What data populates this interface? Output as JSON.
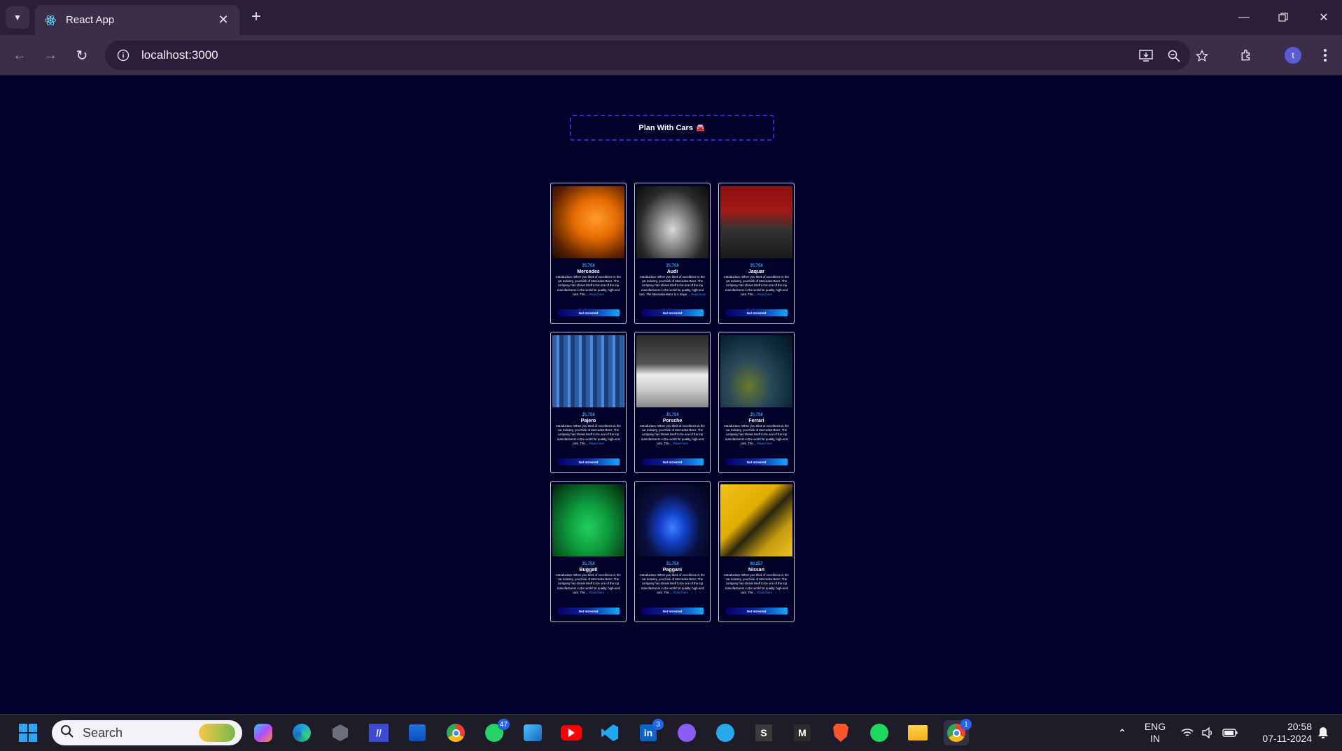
{
  "browser": {
    "tab_title": "React App",
    "url": "localhost:3000",
    "profile_initial": "t"
  },
  "page": {
    "title": "Plan With Cars",
    "title_emoji": "🚘",
    "cards": [
      {
        "price": "35,758",
        "name": "Mercedes",
        "desc": "Introduction: When you think of excellence in the car industry, you think of Mercedes-Benz. The company has shown itself to be one of the top manufacturers in the world for quality, high-end cars. The....",
        "read_more": "Read more",
        "button": "Not Intrested"
      },
      {
        "price": "35,758",
        "name": "Audi",
        "desc": "Introduction: When you think of excellence in the car industry, you think of Mercedes-Benz. The company has shown itself to be one of the top manufacturers in the world for quality, high-end cars. The Mercedes-Benz is a major....",
        "read_more": "Read more",
        "button": "Not Intrested"
      },
      {
        "price": "35,758",
        "name": "Jaquar",
        "desc": "Introduction: When you think of excellence in the car industry, you think of Mercedes-Benz. The company has shown itself to be one of the top manufacturers in the world for quality, high-end cars. The....",
        "read_more": "Read more",
        "button": "Not Intrested"
      },
      {
        "price": "35,758",
        "name": "Pajero",
        "desc": "Introduction: When you think of excellence in the car industry, you think of Mercedes-Benz. The company has shown itself to be one of the top manufacturers in the world for quality, high-end cars. The....",
        "read_more": "Read more",
        "button": "Not Intrested"
      },
      {
        "price": "35,758",
        "name": "Porsche",
        "desc": "Introduction: When you think of excellence in the car industry, you think of Mercedes-Benz. The company has shown itself to be one of the top manufacturers in the world for quality, high-end cars. The....",
        "read_more": "Read more",
        "button": "Not Intrested"
      },
      {
        "price": "35,758",
        "name": "Ferrari",
        "desc": "Introduction: When you think of excellence in the car industry, you think of Mercedes-Benz. The company has shown itself to be one of the top manufacturers in the world for quality, high-end cars. The....",
        "read_more": "Read more",
        "button": "Not Intrested"
      },
      {
        "price": "35,758",
        "name": "Buggati",
        "desc": "Introduction: When you think of excellence in the car industry, you think of Mercedes-Benz. The company has shown itself to be one of the top manufacturers in the world for quality, high-end cars. The....",
        "read_more": "Read more",
        "button": "Not Intrested"
      },
      {
        "price": "35,758",
        "name": "Paggani",
        "desc": "Introduction: When you think of excellence in the car industry, you think of Mercedes-Benz. The company has shown itself to be one of the top manufacturers in the world for quality, high-end cars. The....",
        "read_more": "Read more",
        "button": "Not Intrested"
      },
      {
        "price": "89,257",
        "name": "Nissan",
        "desc": "Introduction: When you think of excellence in the car industry, you think of Mercedes-Benz. The company has shown itself to be one of the top manufacturers in the world for quality, high-end cars. The....",
        "read_more": "Read more",
        "button": "Not Intrested"
      }
    ]
  },
  "taskbar": {
    "search_label": "Search",
    "whatsapp_badge": "47",
    "linkedin_badge": "3",
    "chrome_badge": "1",
    "lang_top": "ENG",
    "lang_bottom": "IN",
    "time": "20:58",
    "date": "07-11-2024"
  },
  "colors": {
    "page_bg": "#03002a",
    "accent": "#21a3ff",
    "title_border": "#2b2bd9"
  }
}
